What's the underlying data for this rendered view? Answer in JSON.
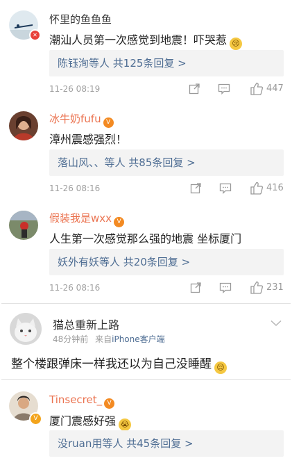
{
  "comments": [
    {
      "username": "怀里的鱼鱼鱼",
      "text": "潮汕人员第一次感觉到地震！吓哭惹",
      "emoji": "tear-face",
      "reply_names": "陈钰洵",
      "reply_rest": "等人 共125条回复 >",
      "time": "11-26 08:19",
      "likes": "447"
    },
    {
      "username": "冰牛奶fufu",
      "text": "漳州震感强烈！",
      "reply_names": "落山风、、",
      "reply_rest": "等人 共85条回复 >",
      "time": "11-26 08:16",
      "likes": "416"
    },
    {
      "username": "假装我是wxx",
      "text": "人生第一次感觉那么强的地震 坐标厦门",
      "reply_names": "妖外有妖",
      "reply_rest": "等人 共20条回复 >",
      "time": "11-26 08:16",
      "likes": "231"
    },
    {
      "username": "猫总重新上路",
      "meta_time": "48分钟前",
      "meta_from": "来自",
      "meta_source": "iPhone客户端",
      "text": "整个楼跟弹床一样我还以为自己没睡醒",
      "emoji": "sleepy-face"
    },
    {
      "username": "Tinsecret_",
      "text": "厦门震感好强",
      "emoji": "crying-face",
      "reply_names": "没ruan用",
      "reply_rest": "等人 共45条回复 >"
    }
  ],
  "colors": {
    "link": "#4e6d93",
    "orange_name": "#eb7350",
    "meta": "#a0a0a0",
    "reply_bg": "#f3f3f3"
  }
}
